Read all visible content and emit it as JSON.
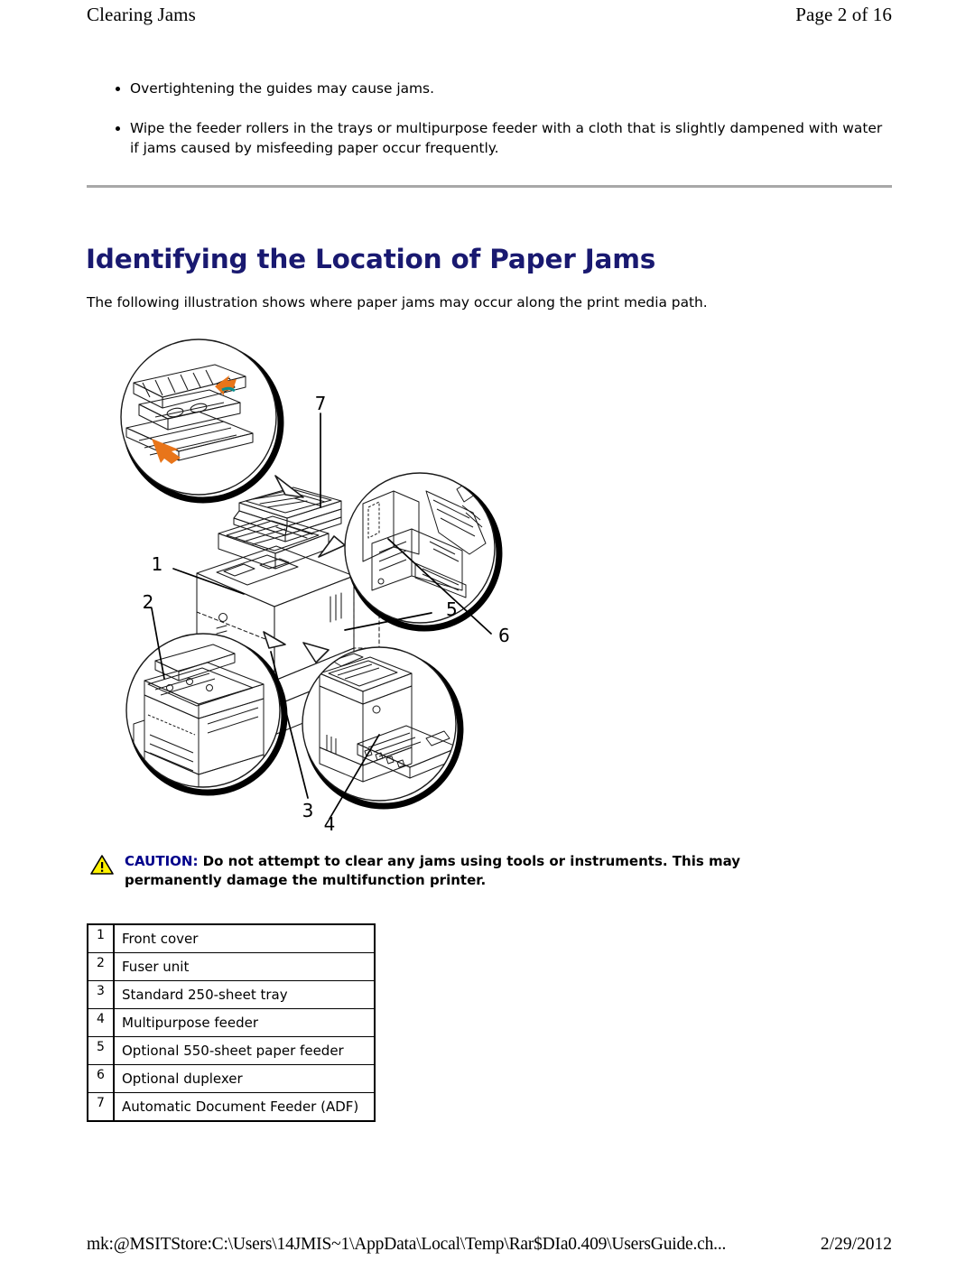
{
  "header": {
    "left_title": "Clearing Jams",
    "page_indicator": "Page 2 of 16"
  },
  "bullets": [
    {
      "text": "Overtightening the guides may cause jams."
    },
    {
      "text": "Wipe the feeder rollers in the trays or multipurpose feeder with a cloth that is slightly dampened with water if jams caused by misfeeding paper occur frequently."
    }
  ],
  "section": {
    "title": "Identifying the Location of Paper Jams",
    "title_color": "#191970",
    "intro": "The following illustration shows where paper jams may occur along the print media path."
  },
  "figure": {
    "alt": "Exploded illustration of a multifunction laser printer with four circular magnified callouts showing paper jam locations",
    "callout_numbers": [
      "1",
      "2",
      "3",
      "4",
      "5",
      "6",
      "7"
    ],
    "arrow_color": "#E8751A",
    "line_color": "#000000"
  },
  "caution": {
    "icon": "warning-triangle-icon",
    "icon_fill": "#FFF200",
    "label": "CAUTION:",
    "label_color": "#00008B",
    "text": " Do not attempt to clear any jams using tools or instruments. This may permanently damage the multifunction printer."
  },
  "legend": {
    "rows": [
      {
        "num": "1",
        "label": "Front cover"
      },
      {
        "num": "2",
        "label": "Fuser unit"
      },
      {
        "num": "3",
        "label": "Standard 250-sheet tray"
      },
      {
        "num": "4",
        "label": "Multipurpose feeder"
      },
      {
        "num": "5",
        "label": "Optional 550-sheet paper feeder"
      },
      {
        "num": "6",
        "label": "Optional duplexer"
      },
      {
        "num": "7",
        "label": "Automatic Document Feeder (ADF)"
      }
    ]
  },
  "footer": {
    "path": "mk:@MSITStore:C:\\Users\\14JMIS~1\\AppData\\Local\\Temp\\Rar$DIa0.409\\UsersGuide.ch...",
    "date": "2/29/2012"
  }
}
